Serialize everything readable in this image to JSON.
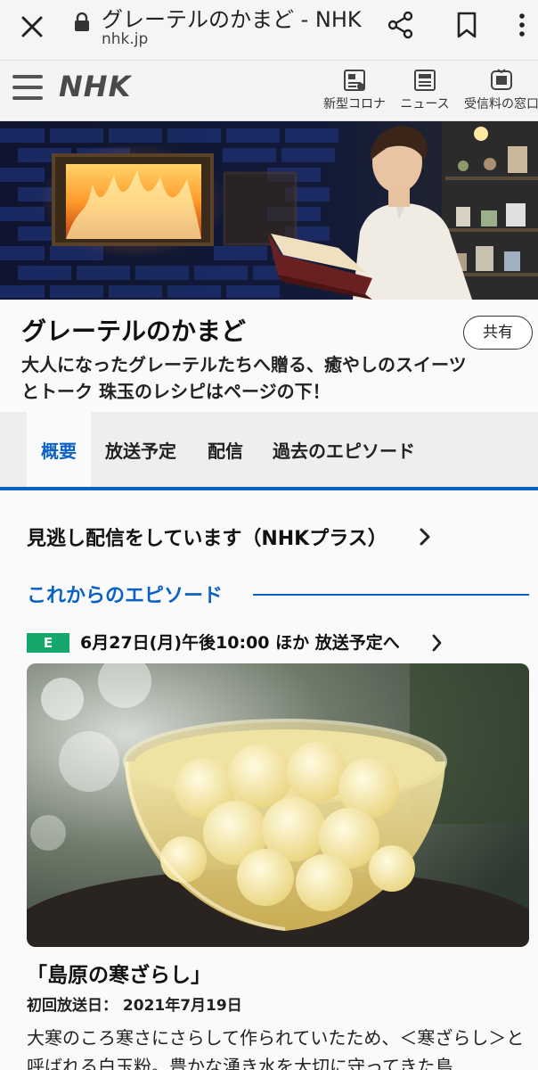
{
  "browser": {
    "title": "グレーテルのかまど - NHK",
    "domain": "nhk.jp"
  },
  "header": {
    "logo": "NHK",
    "nav": [
      {
        "label": "新型コロナ",
        "icon": "corona-info-icon"
      },
      {
        "label": "ニュース",
        "icon": "news-icon"
      },
      {
        "label": "受信料の窓口",
        "icon": "fee-window-icon"
      }
    ]
  },
  "program": {
    "title": "グレーテルのかまど",
    "description": "大人になったグレーテルたちへ贈る、癒やしのスイーツとトーク 珠玉のレシピはページの下！",
    "share_label": "共有"
  },
  "tabs": [
    {
      "label": "概要",
      "active": true
    },
    {
      "label": "放送予定",
      "active": false
    },
    {
      "label": "配信",
      "active": false
    },
    {
      "label": "過去のエピソード",
      "active": false
    }
  ],
  "main": {
    "missed_stream": "見逃し配信をしています（NHKプラス）",
    "section_title": "これからのエピソード",
    "channel_badge": "E",
    "schedule": "6月27日(月)午後10:00 ほか 放送予定へ",
    "episode": {
      "title": "「島原の寒ざらし」",
      "first_broadcast": "初回放送日： 2021年7月19日",
      "description": "大寒のころ寒さにさらして作られていたため、＜寒ざらし＞と呼ばれる白玉粉。豊かな湧き水を大切に守ってきた島"
    }
  },
  "colors": {
    "accent": "#0b62c4",
    "channel_e": "#16a86a"
  }
}
